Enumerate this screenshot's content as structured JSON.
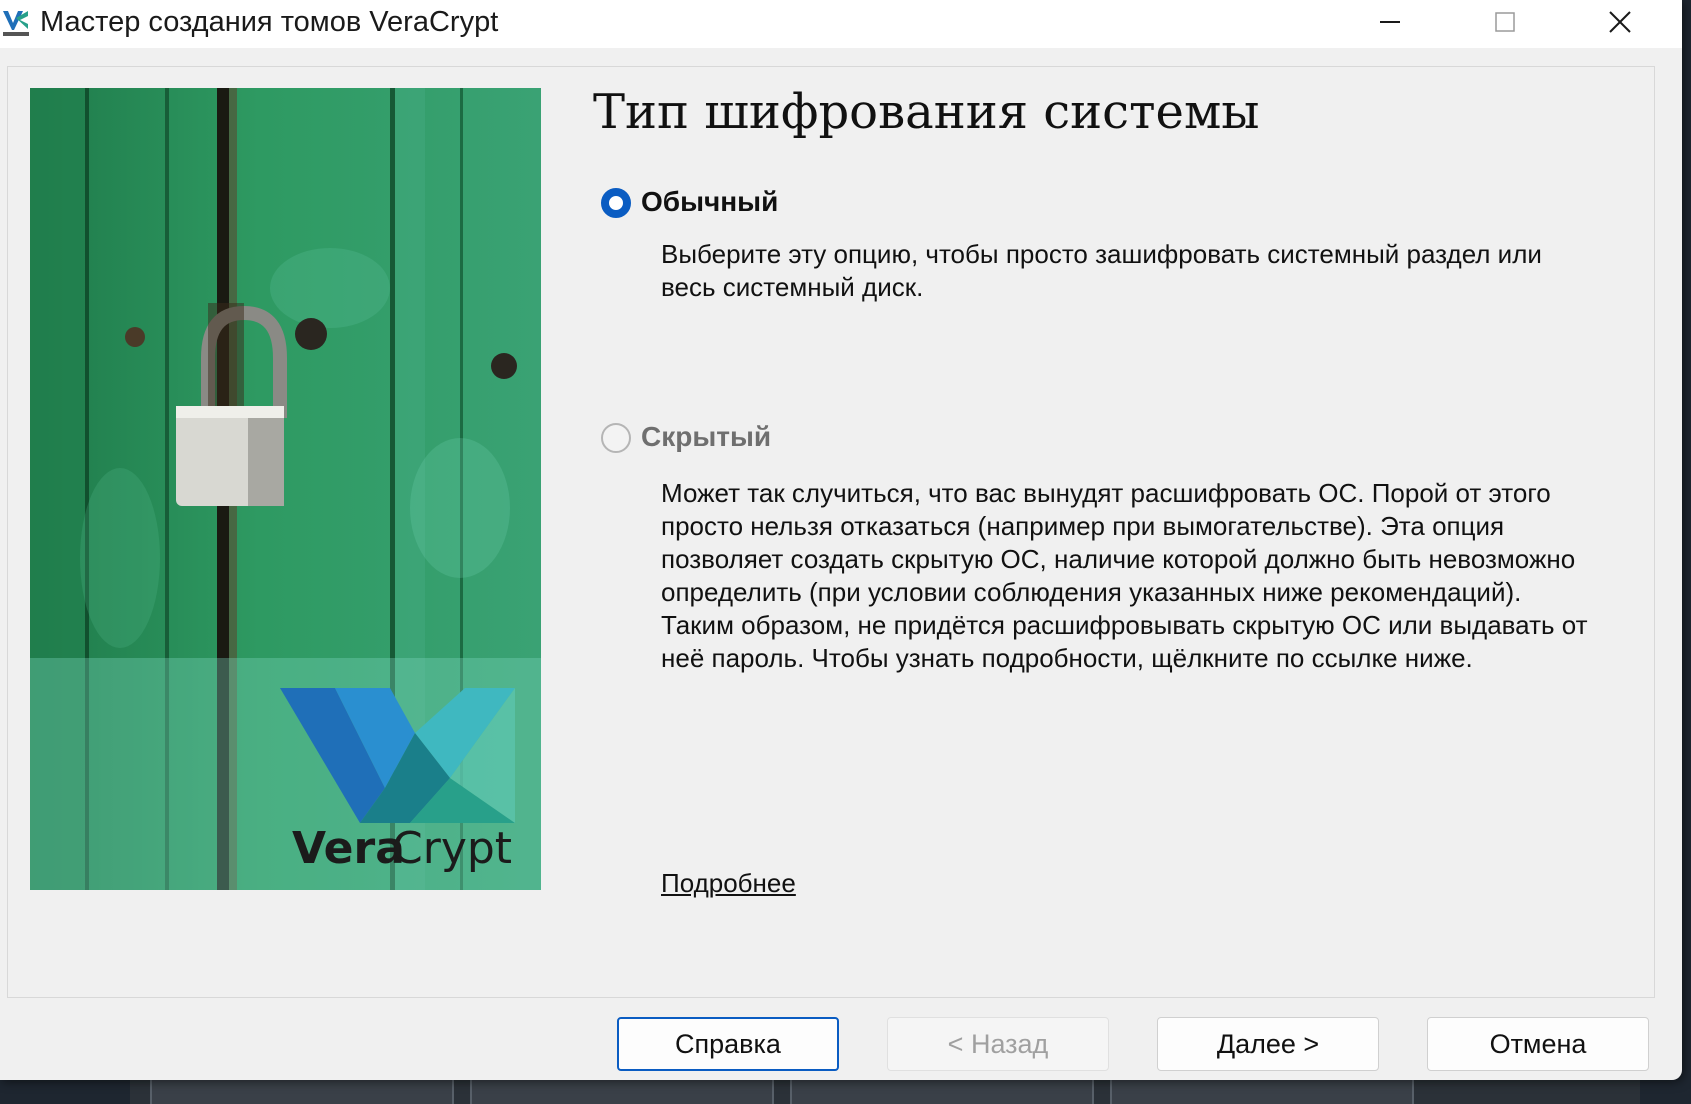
{
  "window": {
    "title": "Мастер создания томов VeraCrypt",
    "app_icon_text": "VeraCrypt"
  },
  "page": {
    "heading": "Тип шифрования системы"
  },
  "options": [
    {
      "label": "Обычный",
      "selected": true,
      "description": "Выберите эту опцию, чтобы просто зашифровать системный раздел или\nвесь системный диск."
    },
    {
      "label": "Скрытый",
      "selected": false,
      "description": "Может так случиться, что вас вынудят расшифровать ОС. Порой от этого\nпросто нельзя отказаться (например при вымогательстве). Эта опция\nпозволяет создать скрытую ОС, наличие которой должно быть невозможно\nопределить (при условии соблюдения указанных ниже рекомендаций).\nТаким образом, не придётся расшифровывать скрытую ОС или выдавать от\nнеё пароль. Чтобы узнать подробности, щёлкните по ссылке ниже."
    }
  ],
  "more_link": "Подробнее",
  "logo": {
    "text_bold": "Vera",
    "text_light": "Crypt"
  },
  "buttons": {
    "help": "Справка",
    "back": "< Назад",
    "next": "Далее >",
    "cancel": "Отмена"
  },
  "colors": {
    "accent": "#0a5cc2",
    "door_green": "#2e9a62"
  }
}
